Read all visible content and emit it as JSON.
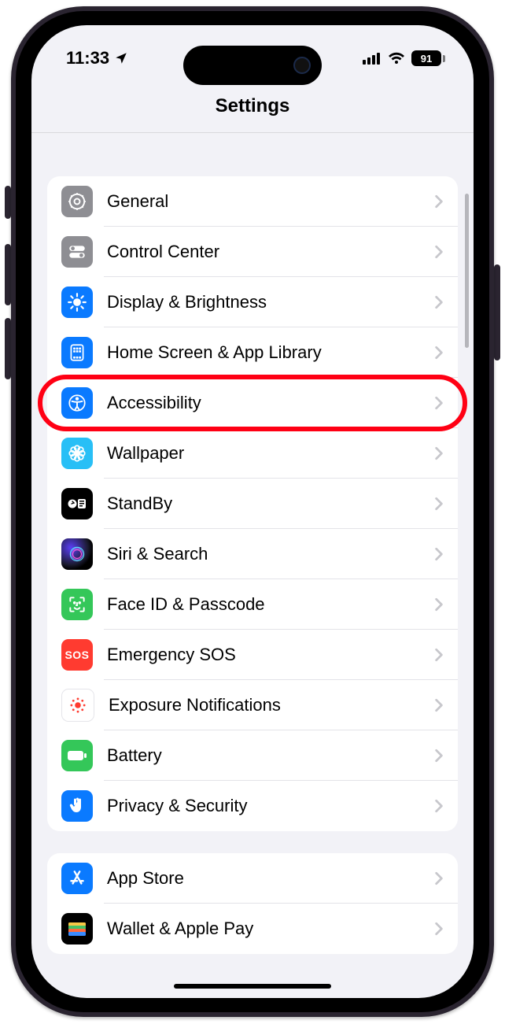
{
  "status": {
    "time": "11:33",
    "battery_pct": "91"
  },
  "navbar": {
    "title": "Settings"
  },
  "group1": {
    "items": [
      {
        "label": "General",
        "icon": "gear",
        "bg": "ic-gray"
      },
      {
        "label": "Control Center",
        "icon": "toggles",
        "bg": "ic-gray"
      },
      {
        "label": "Display & Brightness",
        "icon": "sun",
        "bg": "ic-blue"
      },
      {
        "label": "Home Screen & App Library",
        "icon": "grid",
        "bg": "ic-blue"
      },
      {
        "label": "Accessibility",
        "icon": "person",
        "bg": "ic-blue",
        "highlight": true
      },
      {
        "label": "Wallpaper",
        "icon": "flower",
        "bg": "ic-cyan"
      },
      {
        "label": "StandBy",
        "icon": "standby",
        "bg": "ic-black"
      },
      {
        "label": "Siri & Search",
        "icon": "siri",
        "bg": "ic-siri"
      },
      {
        "label": "Face ID & Passcode",
        "icon": "face",
        "bg": "ic-green"
      },
      {
        "label": "Emergency SOS",
        "icon": "sos",
        "bg": "ic-red"
      },
      {
        "label": "Exposure Notifications",
        "icon": "exposure",
        "bg": "ic-white"
      },
      {
        "label": "Battery",
        "icon": "battery",
        "bg": "ic-green"
      },
      {
        "label": "Privacy & Security",
        "icon": "hand",
        "bg": "ic-blue"
      }
    ]
  },
  "group2": {
    "items": [
      {
        "label": "App Store",
        "icon": "appstore",
        "bg": "ic-blue"
      },
      {
        "label": "Wallet & Apple Pay",
        "icon": "wallet",
        "bg": "ic-wallet"
      }
    ]
  },
  "sos_text": "SOS"
}
